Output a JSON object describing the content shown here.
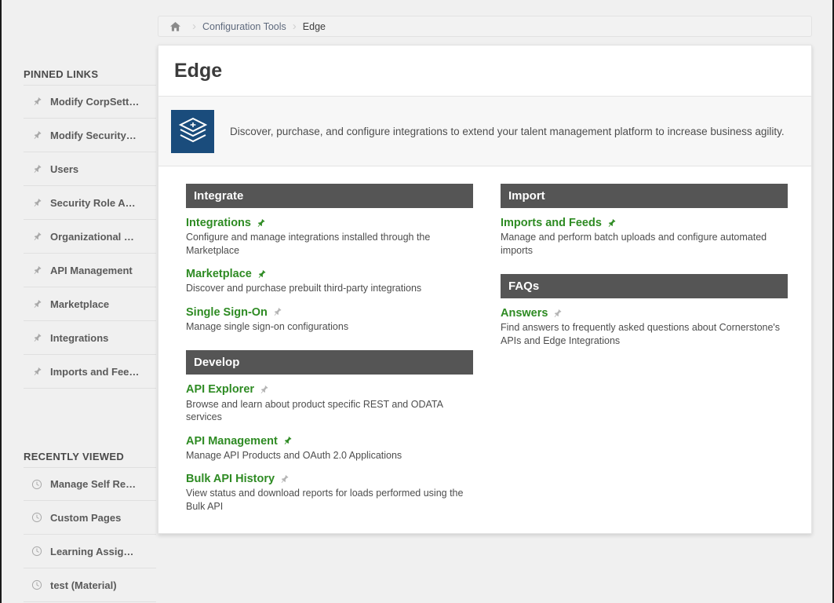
{
  "colors": {
    "link_green": "#2e8b23",
    "section_header_bg": "#555555",
    "logo_bg": "#1a4c7c",
    "page_bg": "#f0f0f0",
    "breadcrumb_link": "#5f6a7d"
  },
  "breadcrumb": {
    "home_icon": "home-icon",
    "separator": "›",
    "items": [
      {
        "label": "Configuration Tools",
        "current": false
      },
      {
        "label": "Edge",
        "current": true
      }
    ]
  },
  "sidebar": {
    "pinned_heading": "PINNED LINKS",
    "pinned_items": [
      {
        "label": "Modify CorpSett…",
        "icon": "pin-icon"
      },
      {
        "label": "Modify Security…",
        "icon": "pin-icon"
      },
      {
        "label": "Users",
        "icon": "pin-icon"
      },
      {
        "label": "Security Role A…",
        "icon": "pin-icon"
      },
      {
        "label": "Organizational …",
        "icon": "pin-icon"
      },
      {
        "label": "API Management",
        "icon": "pin-icon"
      },
      {
        "label": "Marketplace",
        "icon": "pin-icon"
      },
      {
        "label": "Integrations",
        "icon": "pin-icon"
      },
      {
        "label": "Imports and Fee…",
        "icon": "pin-icon"
      }
    ],
    "recent_heading": "RECENTLY VIEWED",
    "recent_items": [
      {
        "label": "Manage Self Re…",
        "icon": "clock-icon"
      },
      {
        "label": "Custom Pages",
        "icon": "clock-icon"
      },
      {
        "label": "Learning Assig…",
        "icon": "clock-icon"
      },
      {
        "label": "test (Material)",
        "icon": "clock-icon"
      }
    ]
  },
  "page": {
    "title": "Edge",
    "logo_icon": "layers-stack-icon",
    "banner_description": "Discover, purchase, and configure integrations to extend your talent management platform to increase business agility."
  },
  "sections": {
    "left": [
      {
        "header": "Integrate",
        "links": [
          {
            "title": "Integrations",
            "pinned": true,
            "description": "Configure and manage integrations installed through the Marketplace"
          },
          {
            "title": "Marketplace",
            "pinned": true,
            "description": "Discover and purchase prebuilt third-party integrations"
          },
          {
            "title": "Single Sign-On",
            "pinned": false,
            "description": "Manage single sign-on configurations"
          }
        ]
      },
      {
        "header": "Develop",
        "links": [
          {
            "title": "API Explorer",
            "pinned": false,
            "description": "Browse and learn about product specific REST and ODATA services"
          },
          {
            "title": "API Management",
            "pinned": true,
            "description": "Manage API Products and OAuth 2.0 Applications"
          },
          {
            "title": "Bulk API History",
            "pinned": false,
            "description": "View status and download reports for loads performed using the Bulk API"
          }
        ]
      }
    ],
    "right": [
      {
        "header": "Import",
        "links": [
          {
            "title": "Imports and Feeds",
            "pinned": true,
            "description": "Manage and perform batch uploads and configure automated imports"
          }
        ]
      },
      {
        "header": "FAQs",
        "links": [
          {
            "title": "Answers",
            "pinned": false,
            "description": "Find answers to frequently asked questions about Cornerstone's APIs and Edge Integrations"
          }
        ]
      }
    ]
  }
}
